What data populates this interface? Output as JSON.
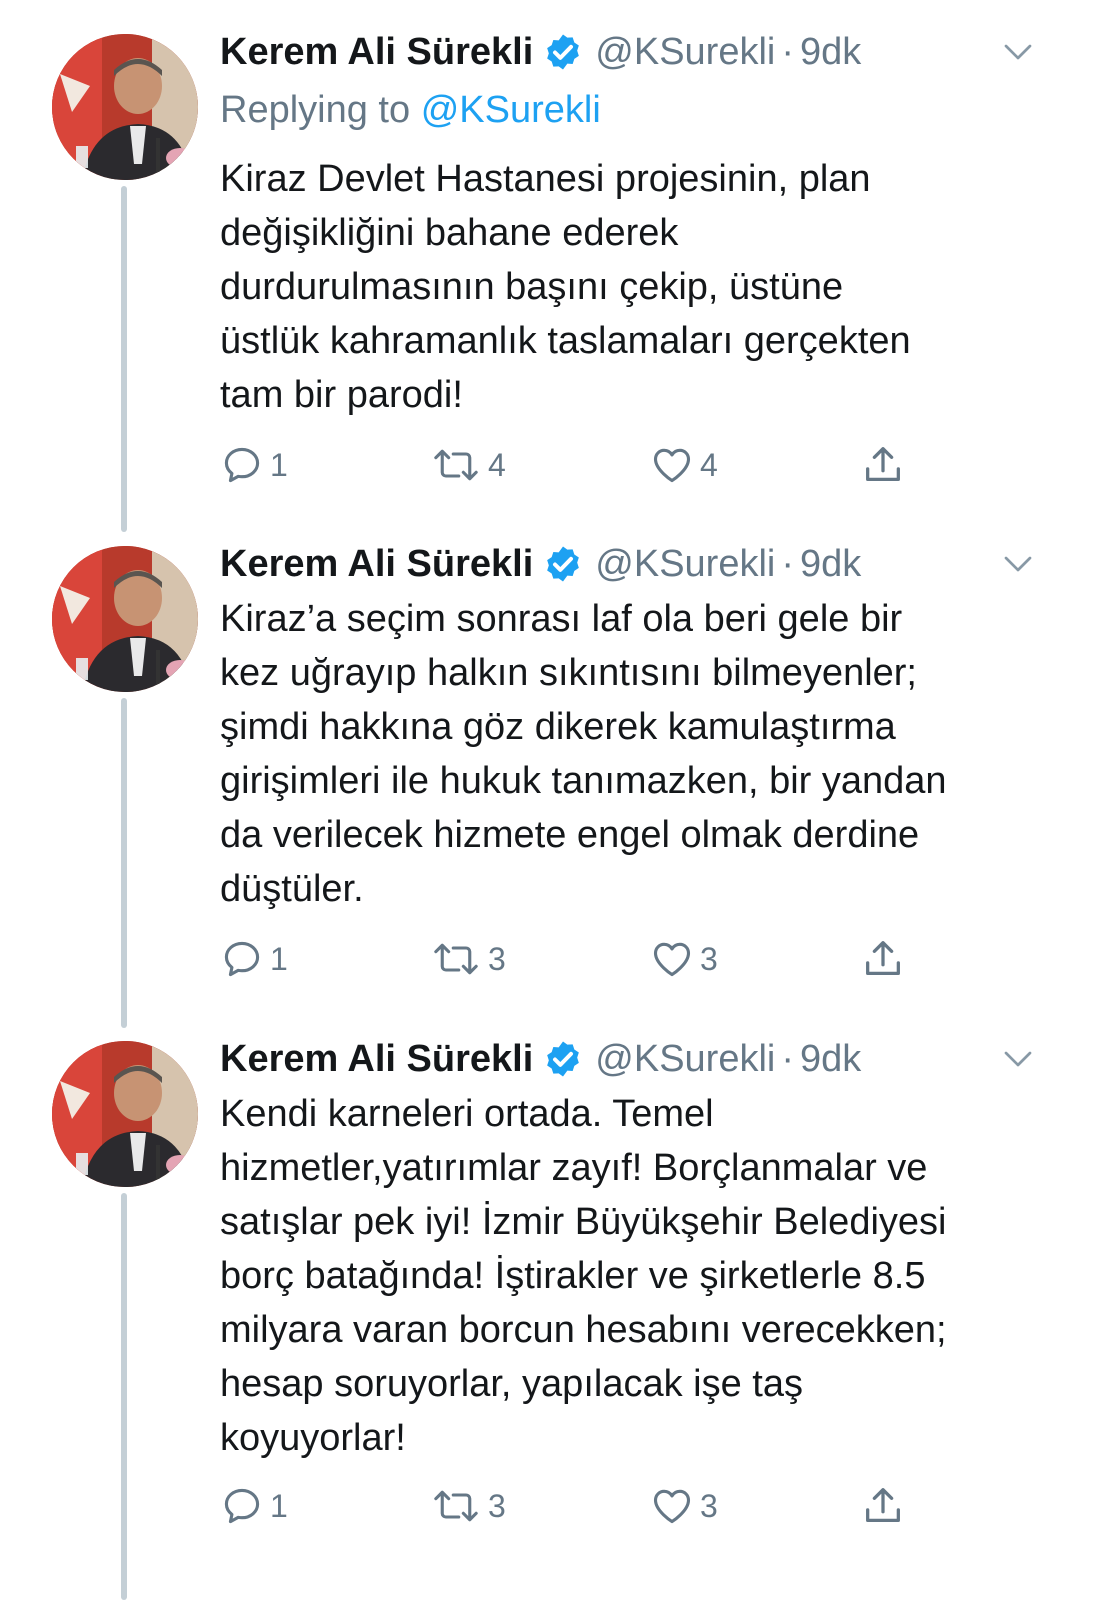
{
  "tweets": [
    {
      "author_name": "Kerem Ali Sürekli",
      "handle": "@KSurekli",
      "separator": "·",
      "time": "9dk",
      "replying_label": "Replying to",
      "replying_mention": "@KSurekli",
      "text": "Kiraz Devlet Hastanesi projesinin, plan\ndeğişikliğini bahane ederek\ndurdurulmasının başını çekip, üstüne\nüstlük kahramanlık taslamaları gerçekten\ntam bir parodi!",
      "replies": "1",
      "retweets": "4",
      "likes": "4"
    },
    {
      "author_name": "Kerem Ali Sürekli",
      "handle": "@KSurekli",
      "separator": "·",
      "time": "9dk",
      "text": "Kiraz’a seçim sonrası laf ola beri gele bir\nkez uğrayıp halkın sıkıntısını bilmeyenler;\nşimdi hakkına göz dikerek kamulaştırma\ngirişimleri ile hukuk tanımazken, bir yandan\nda verilecek hizmete engel olmak derdine\ndüştüler.",
      "replies": "1",
      "retweets": "3",
      "likes": "3"
    },
    {
      "author_name": "Kerem Ali Sürekli",
      "handle": "@KSurekli",
      "separator": "·",
      "time": "9dk",
      "text": "Kendi karneleri ortada. Temel\nhizmetler,yatırımlar zayıf! Borçlanmalar ve\nsatışlar pek iyi! İzmir Büyükşehir Belediyesi\nborç batağında! İştirakler ve şirketlerle 8.5\nmilyara varan borcun hesabını verecekken;\nhesap soruyorlar, yapılacak işe taş\nkoyuyorlar!",
      "replies": "1",
      "retweets": "3",
      "likes": "3"
    }
  ],
  "icons": {
    "verified": "verified-badge-icon",
    "more": "chevron-down-icon",
    "reply": "reply-icon",
    "retweet": "retweet-icon",
    "like": "heart-icon",
    "share": "share-icon"
  },
  "colors": {
    "accent": "#1da1f2",
    "secondary_text": "#657786",
    "thread_line": "#c4cfd6"
  }
}
